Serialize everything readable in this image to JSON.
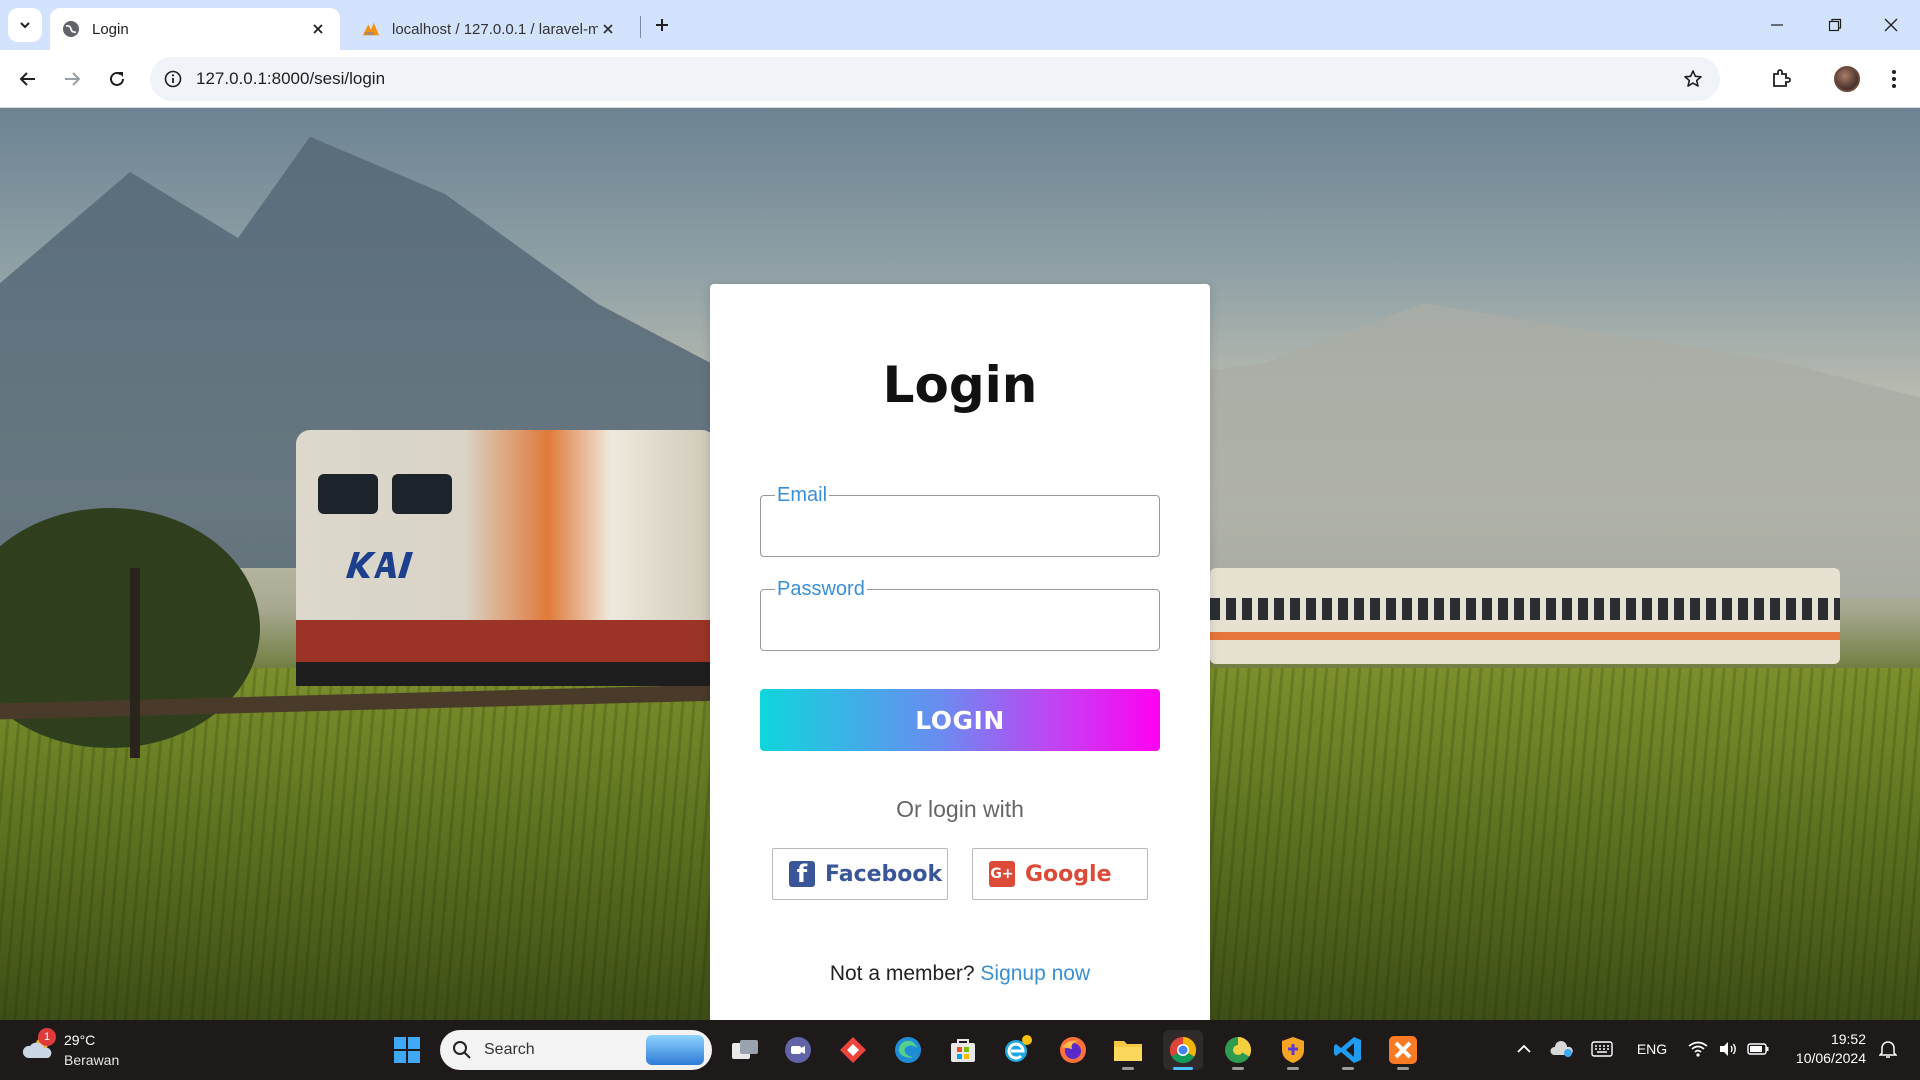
{
  "browser": {
    "tabs": [
      {
        "title": "Login",
        "favicon": "globe-icon",
        "active": true
      },
      {
        "title": "localhost / 127.0.0.1 / laravel-m",
        "favicon": "phpmyadmin-icon",
        "active": false
      }
    ],
    "url": "127.0.0.1:8000/sesi/login"
  },
  "login": {
    "title": "Login",
    "email_label": "Email",
    "email_value": "",
    "password_label": "Password",
    "password_value": "",
    "submit_label": "LOGIN",
    "or_text": "Or login with",
    "facebook_label": "Facebook",
    "facebook_icon_glyph": "f",
    "google_label": "Google",
    "google_icon_glyph": "G+",
    "signup_prompt": "Not a member?",
    "signup_link": "Signup now"
  },
  "colors": {
    "accent_blue": "#3a8fd6",
    "gradient_start": "#0fd6dc",
    "gradient_end": "#ff00f2",
    "facebook": "#3b5698",
    "google": "#dc4a38"
  },
  "taskbar": {
    "weather_badge": "1",
    "weather_temp": "29°C",
    "weather_desc": "Berawan",
    "search_label": "Search",
    "language": "ENG",
    "time": "19:52",
    "date": "10/06/2024"
  }
}
